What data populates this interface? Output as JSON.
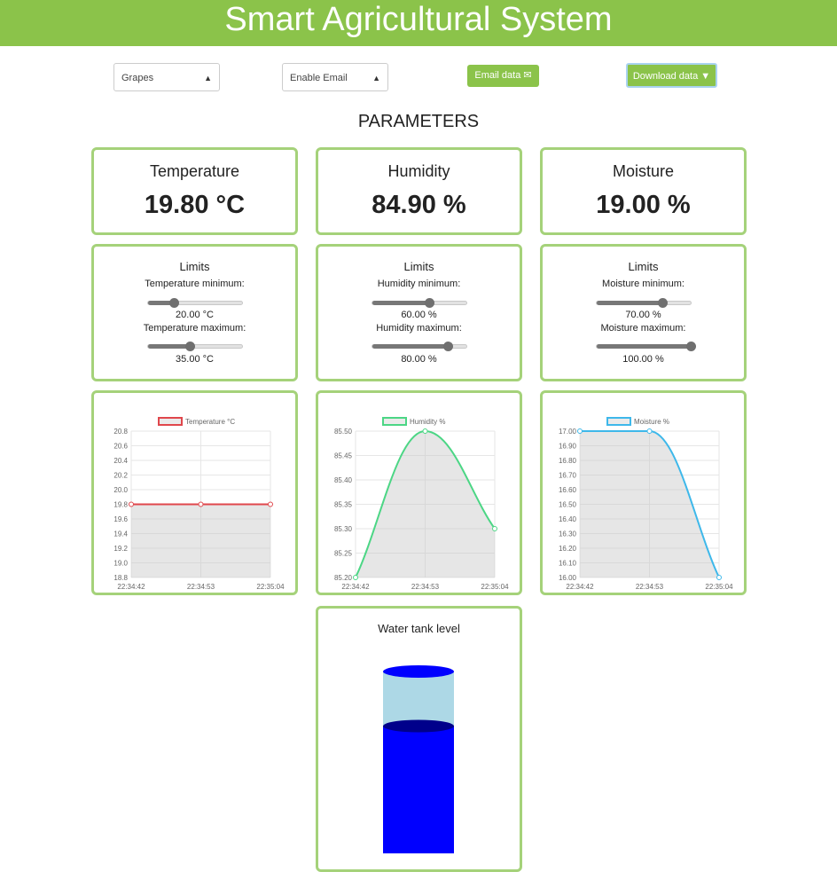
{
  "header": {
    "title": "Smart Agricultural System"
  },
  "controls": {
    "crop_select": "Grapes",
    "email_select": "Enable Email",
    "email_button": "Email data",
    "download_button": "Download data"
  },
  "section_title": "PARAMETERS",
  "params": [
    {
      "name": "Temperature",
      "value": "19.80 °C"
    },
    {
      "name": "Humidity",
      "value": "84.90 %"
    },
    {
      "name": "Moisture",
      "value": "19.00 %"
    }
  ],
  "limits": [
    {
      "title": "Limits",
      "min_label": "Temperature minimum:",
      "min_value": "20.00 °C",
      "min_fraction": 0.27,
      "max_label": "Temperature maximum:",
      "max_value": "35.00 °C",
      "max_fraction": 0.44
    },
    {
      "title": "Limits",
      "min_label": "Humidity minimum:",
      "min_value": "60.00 %",
      "min_fraction": 0.6,
      "max_label": "Humidity maximum:",
      "max_value": "80.00 %",
      "max_fraction": 0.8
    },
    {
      "title": "Limits",
      "min_label": "Moisture minimum:",
      "min_value": "70.00 %",
      "min_fraction": 0.7,
      "max_label": "Moisture maximum:",
      "max_value": "100.00 %",
      "max_fraction": 1.0
    }
  ],
  "chart_data": [
    {
      "type": "line",
      "series_name": "Temperature °C",
      "color": "#e0474c",
      "x": [
        "22:34:42",
        "22:34:53",
        "22:35:04"
      ],
      "values": [
        19.8,
        19.8,
        19.8
      ],
      "ylim": [
        18.8,
        20.8
      ],
      "yticks": [
        "20.8",
        "20.6",
        "20.4",
        "20.2",
        "20.0",
        "19.8",
        "19.6",
        "19.4",
        "19.2",
        "19.0",
        "18.8"
      ]
    },
    {
      "type": "line",
      "series_name": "Humidity %",
      "color": "#4cd685",
      "x": [
        "22:34:42",
        "22:34:53",
        "22:35:04"
      ],
      "values": [
        85.2,
        85.5,
        85.3
      ],
      "ylim": [
        85.2,
        85.5
      ],
      "yticks": [
        "85.50",
        "85.45",
        "85.40",
        "85.35",
        "85.30",
        "85.25",
        "85.20"
      ]
    },
    {
      "type": "line",
      "series_name": "Moisture %",
      "color": "#3eb8ea",
      "x": [
        "22:34:42",
        "22:34:53",
        "22:35:04"
      ],
      "values": [
        17.0,
        17.0,
        16.0
      ],
      "ylim": [
        16.0,
        17.0
      ],
      "yticks": [
        "17.00",
        "16.90",
        "16.80",
        "16.70",
        "16.60",
        "16.50",
        "16.40",
        "16.30",
        "16.20",
        "16.10",
        "16.00"
      ]
    }
  ],
  "tank": {
    "title": "Water tank level",
    "level_fraction": 0.7
  },
  "colors": {
    "accent": "#8bc34a",
    "card_border": "#a5d27a",
    "water": "#0000ff",
    "tank_empty": "#add8e6"
  }
}
